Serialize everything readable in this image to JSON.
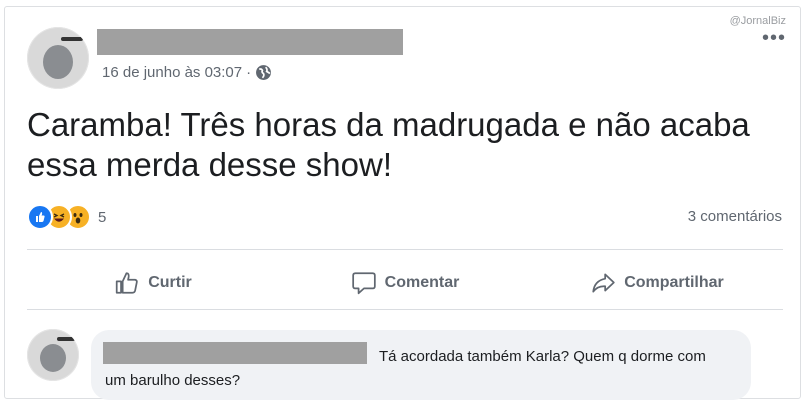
{
  "watermark": "@JornalBiz",
  "post": {
    "date": "16 de junho às 03:07",
    "meta_separator": "·",
    "text": "Caramba! Três horas da madrugada e não acaba essa merda desse show!",
    "reaction_count": "5",
    "comments_count": "3 comentários",
    "reactions": [
      "like",
      "haha",
      "wow"
    ]
  },
  "actions": {
    "like_label": "Curtir",
    "comment_label": "Comentar",
    "share_label": "Compartilhar"
  },
  "comment": {
    "text": "Tá acordada também Karla? Quem q dorme com um barulho desses?"
  },
  "colors": {
    "like_blue": "#1877f2",
    "emoji_yellow": "#f7b125",
    "secondary_text": "#606770",
    "redaction": "#a0a0a0"
  }
}
